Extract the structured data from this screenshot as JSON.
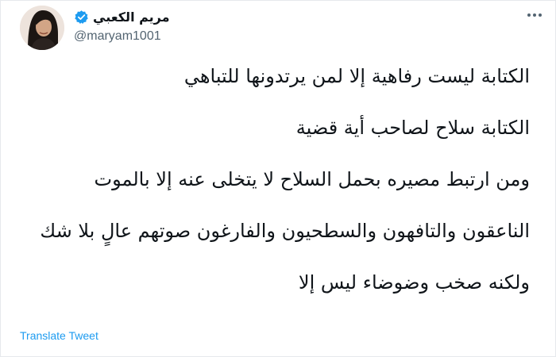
{
  "user": {
    "display_name": "مريم الكعبي",
    "handle": "@maryam1001",
    "verified": true,
    "avatar_icon": "profile-photo"
  },
  "tweet": {
    "paragraphs": [
      "الكتابة ليست رفاهية إلا لمن يرتدونها للتباهي",
      "الكتابة سلاح لصاحب أية قضية",
      "ومن ارتبط مصيره بحمل السلاح لا يتخلى عنه إلا بالموت",
      "الناعقون والتافهون والسطحيون والفارغون صوتهم عالٍ بلا شك",
      "ولكنه صخب وضوضاء ليس إلا"
    ],
    "translate_label": "Translate Tweet"
  },
  "icons": {
    "more": "more-horizontal-icon",
    "verified": "verified-badge-icon"
  },
  "colors": {
    "accent": "#1d9bf0",
    "text": "#0f1419",
    "secondary_text": "#536471"
  }
}
